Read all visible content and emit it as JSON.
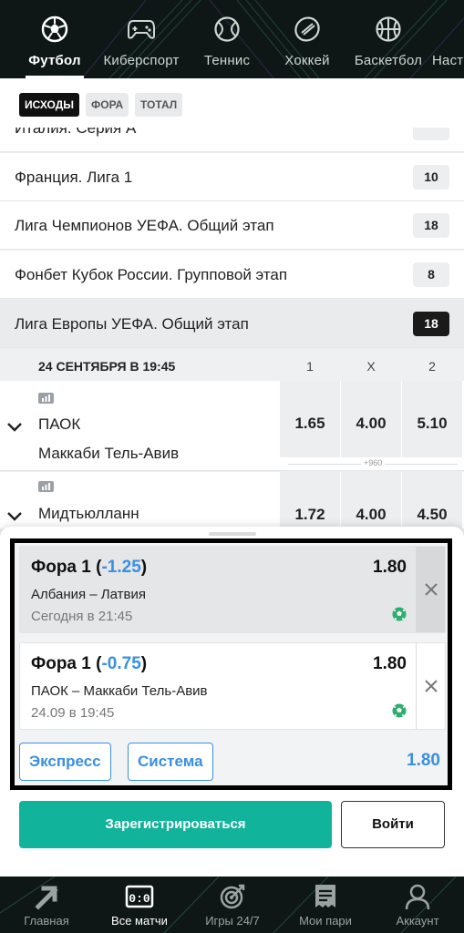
{
  "sports_tabs": [
    {
      "label": "Футбол",
      "icon": "football-icon",
      "active": true
    },
    {
      "label": "Киберспорт",
      "icon": "gamepad-icon",
      "active": false
    },
    {
      "label": "Теннис",
      "icon": "tennis-ball-icon",
      "active": false
    },
    {
      "label": "Хоккей",
      "icon": "hockey-puck-icon",
      "active": false
    },
    {
      "label": "Баскетбол",
      "icon": "basketball-icon",
      "active": false
    },
    {
      "label": "Наст",
      "icon": "table-tennis-icon",
      "active": false
    }
  ],
  "filters": {
    "outcomes": "ИСХОДЫ",
    "handicap": "ФОРА",
    "total": "ТОТАЛ"
  },
  "tournaments": [
    {
      "name": "Италия. Серия А",
      "count": ""
    },
    {
      "name": "Франция. Лига 1",
      "count": "10"
    },
    {
      "name": "Лига Чемпионов УЕФА. Общий этап",
      "count": "18"
    },
    {
      "name": "Фонбет Кубок России. Групповой этап",
      "count": "8"
    },
    {
      "name": "Лига Европы УЕФА. Общий этап",
      "count": "18"
    }
  ],
  "date_header": {
    "date": "24 СЕНТЯБРЯ В 19:45",
    "col1": "1",
    "colx": "X",
    "col2": "2"
  },
  "matches": [
    {
      "team1": "ПАОК",
      "team2": "Маккаби Тель-Авив",
      "odd1": "1.65",
      "oddx": "4.00",
      "odd2": "5.10",
      "more": "+960"
    },
    {
      "team1": "Мидтьюлланн",
      "team2": "",
      "odd1": "1.72",
      "oddx": "4.00",
      "odd2": "4.50",
      "more": ""
    }
  ],
  "bet_slip": {
    "coupons": [
      {
        "bet_prefix": "Фора 1 (",
        "handicap": "-1.25",
        "bet_suffix": ")",
        "odds": "1.80",
        "event": "Албания – Латвия",
        "time": "Сегодня в 21:45"
      },
      {
        "bet_prefix": "Фора 1 (",
        "handicap": "-0.75",
        "bet_suffix": ")",
        "odds": "1.80",
        "event": "ПАОК – Маккаби Тель-Авив",
        "time": "24.09 в 19:45"
      }
    ],
    "express_label": "Экспресс",
    "system_label": "Система",
    "total_odds": "1.80",
    "register_label": "Зарегистрироваться",
    "login_label": "Войти"
  },
  "bottom_nav": [
    {
      "label": "Главная",
      "icon": "home-arrow-icon",
      "active": false
    },
    {
      "label": "Все матчи",
      "icon": "scoreboard-icon",
      "active": true
    },
    {
      "label": "Игры 24/7",
      "icon": "target-icon",
      "active": false
    },
    {
      "label": "Мои пари",
      "icon": "coupon-icon",
      "active": false
    },
    {
      "label": "Аккаунт",
      "icon": "user-icon",
      "active": false
    }
  ],
  "colors": {
    "accent_blue": "#3a8fe0",
    "register_green": "#12b39b",
    "dark_bar": "#0e1715"
  }
}
